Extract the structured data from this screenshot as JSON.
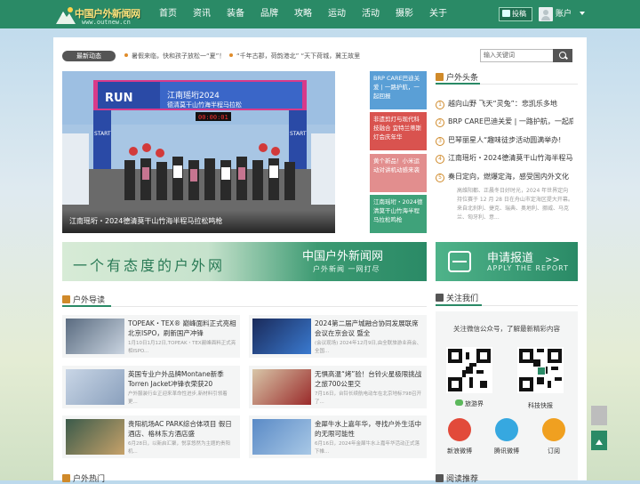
{
  "header": {
    "logo_title": "中国户外新闻网",
    "logo_url": "www.outnew.cn",
    "nav": [
      "首页",
      "资讯",
      "装备",
      "品牌",
      "攻略",
      "运动",
      "活动",
      "摄影",
      "关于"
    ],
    "contribute": "投稿",
    "account": "账户"
  },
  "ticker": {
    "label": "最新动态",
    "items": [
      "暑假来临，快和孩子放松一“夏”！",
      "“千年古郡，荷韵港北” “天下荷城，冀王故里"
    ]
  },
  "search": {
    "placeholder": "输入关键词"
  },
  "hero": {
    "caption": "江南瑶垳・2024德清莫干山竹海半程马拉松鸣枪"
  },
  "side_tiles": [
    {
      "text": "BRP CARE巴迪关爱 | 一路护航，一起回报",
      "color": "#5a9fd6"
    },
    {
      "text": "非遗剪灯与现代科技融合 宜特兰蒂斯灯会庆年华",
      "color": "#d9534f"
    },
    {
      "text": "黄个新品！小米运动对讲机动感来袭",
      "color": "#e28e8e"
    },
    {
      "text": "江南瑶垳・2024德清莫干山竹海半程马拉松鸣枪",
      "color": "#3fa27a"
    }
  ],
  "outdoor_news": {
    "title": "户外头条",
    "items": [
      "越向山野 飞天“灵兔”：悲凯乐多地",
      "BRP CARE巴迪关爱 | 一路护航，一起庇",
      "巴琴丽星人“趣味徒步活动圆满举办!",
      "江南瑶垳・2024德清莫干山竹海半程马",
      "奏日定向，燃爆定海，感受国内外文化"
    ],
    "feature_text": "高维阳都、正晨冬日好时光，2024 年世界定向持位赛于 12 月 28 日在舟山市定海区提大开幕。来自北刹利、捷克、瑞典、奥地利、挪威、马克兰、匈牙利、意..."
  },
  "banner1": {
    "slogan": "一个有态度的户外网",
    "name": "中国户外新闻网",
    "sub": "户外新闻 一网打尽"
  },
  "banner2": {
    "title": "申请报道",
    "sub": "APPLY THE REPORT",
    "arrow": ">>"
  },
  "guide": {
    "title": "户外导读",
    "cards": [
      {
        "title": "TOPEAK・TEX® 巅峰面料正式亮相北京ISPO，刷新国产冲锋",
        "desc": "1月10日1月12日,TOPEAK・TEX巅峰面料正式亮相ISPO...",
        "colors": [
          "#5a6b80",
          "#c9d4e0"
        ]
      },
      {
        "title": "2024第二届产城融合协同发展联席会议在京会议 暨全",
        "desc": "(会议现场) 2024年12月9日,由全联旅游业商会、全国...",
        "colors": [
          "#1a2a5a",
          "#3a7ad0"
        ]
      },
      {
        "title": "英国专业户外品牌Montane新季Torren Jacket冲锋衣荣获20",
        "desc": "户外服装行业正迎来革命性进步,新材料引领着更...",
        "colors": [
          "#c9d6e6",
          "#8aa0bd"
        ]
      },
      {
        "title": "无惧高温“烤”验！台铃火星极限挑战之旅700公里交",
        "desc": "7月16日，台铃长续航电动车在北京地标798召开了...",
        "colors": [
          "#d8c6a8",
          "#9a2a2a"
        ]
      },
      {
        "title": "贵阳机场AC PARK综合体项目 假日酒店、格林东方酒店盛",
        "desc": "6月28日，以新启汇聚，悦享悠然为主题的贵阳机...",
        "colors": [
          "#3a5a4a",
          "#c7a26a"
        ]
      },
      {
        "title": "金犀牛水上嘉年华，寻找户外生活中的无限可能性",
        "desc": "6月16日，2024年金犀牛水上嘉年华活动正式落下帷...",
        "colors": [
          "#5a8ac6",
          "#a8c8e6"
        ]
      }
    ]
  },
  "follow": {
    "title": "关注我们",
    "intro": "关注微信公众号，了解最新精彩内容",
    "qr1": "旅游界",
    "qr2": "科技快报",
    "socials": [
      "新浪微博",
      "腾讯微博",
      "订阅"
    ]
  },
  "bottom_titles": {
    "left": "户外热门",
    "right": "阅读推荐"
  }
}
